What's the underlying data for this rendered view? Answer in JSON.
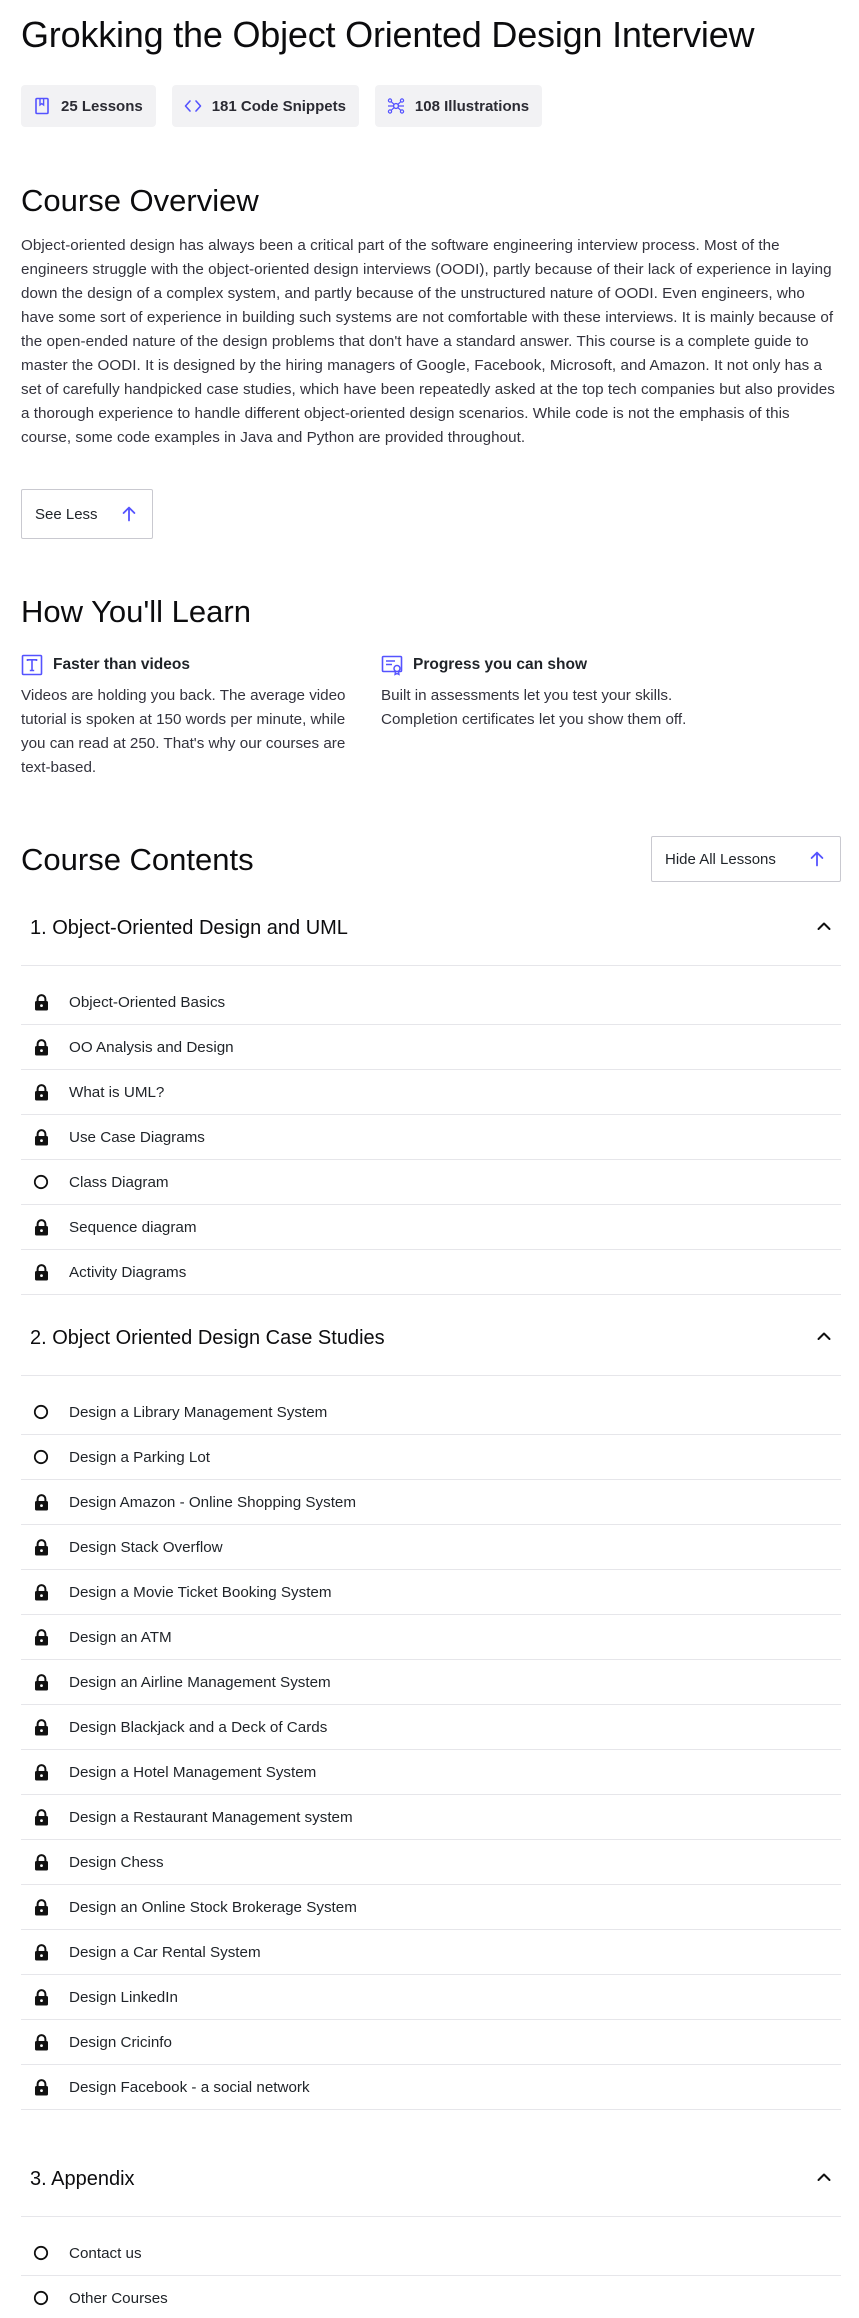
{
  "course": {
    "title": "Grokking the Object Oriented Design Interview",
    "stats": [
      {
        "icon": "book-icon",
        "label": "25 Lessons"
      },
      {
        "icon": "code-icon",
        "label": "181 Code Snippets"
      },
      {
        "icon": "illustration-icon",
        "label": "108 Illustrations"
      }
    ]
  },
  "overview": {
    "heading": "Course Overview",
    "text": "Object-oriented design has always been a critical part of the software engineering interview process. Most of the engineers struggle with the object-oriented design interviews (OODI), partly because of their lack of experience in laying down the design of a complex system, and partly because of the unstructured nature of OODI. Even engineers, who have some sort of experience in building such systems are not comfortable with these interviews. It is mainly because of the open-ended nature of the design problems that don't have a standard answer. This course is a complete guide to master the OODI. It is designed by the hiring managers of Google, Facebook, Microsoft, and Amazon. It not only has a set of carefully handpicked case studies, which have been repeatedly asked at the top tech companies but also provides a thorough experience to handle different object-oriented design scenarios. While code is not the emphasis of this course, some code examples in Java and Python are provided throughout.",
    "toggle_label": "See Less"
  },
  "learn": {
    "heading": "How You'll Learn",
    "items": [
      {
        "icon": "text-icon",
        "title": "Faster than videos",
        "text": "Videos are holding you back. The average video tutorial is spoken at 150 words per minute, while you can read at 250. That's why our courses are text-based."
      },
      {
        "icon": "certificate-icon",
        "title": "Progress you can show",
        "text": "Built in assessments let you test your skills. Completion certificates let you show them off."
      }
    ]
  },
  "contents": {
    "heading": "Course Contents",
    "toggle_all_label": "Hide All Lessons",
    "sections": [
      {
        "title": "1. Object-Oriented Design and UML",
        "lessons": [
          {
            "label": "Object-Oriented Basics",
            "status": "locked"
          },
          {
            "label": "OO Analysis and Design",
            "status": "locked"
          },
          {
            "label": "What is UML?",
            "status": "locked"
          },
          {
            "label": "Use Case Diagrams",
            "status": "locked"
          },
          {
            "label": "Class Diagram",
            "status": "open"
          },
          {
            "label": "Sequence diagram",
            "status": "locked"
          },
          {
            "label": "Activity Diagrams",
            "status": "locked"
          }
        ]
      },
      {
        "title": "2. Object Oriented Design Case Studies",
        "lessons": [
          {
            "label": "Design a Library Management System",
            "status": "open"
          },
          {
            "label": "Design a Parking Lot",
            "status": "open"
          },
          {
            "label": "Design Amazon - Online Shopping System",
            "status": "locked"
          },
          {
            "label": "Design Stack Overflow",
            "status": "locked"
          },
          {
            "label": "Design a Movie Ticket Booking System",
            "status": "locked"
          },
          {
            "label": "Design an ATM",
            "status": "locked"
          },
          {
            "label": "Design an Airline Management System",
            "status": "locked"
          },
          {
            "label": "Design Blackjack and a Deck of Cards",
            "status": "locked"
          },
          {
            "label": "Design a Hotel Management System",
            "status": "locked"
          },
          {
            "label": "Design a Restaurant Management system",
            "status": "locked"
          },
          {
            "label": "Design Chess",
            "status": "locked"
          },
          {
            "label": "Design an Online Stock Brokerage System",
            "status": "locked"
          },
          {
            "label": "Design a Car Rental System",
            "status": "locked"
          },
          {
            "label": "Design LinkedIn",
            "status": "locked"
          },
          {
            "label": "Design Cricinfo",
            "status": "locked"
          },
          {
            "label": "Design Facebook - a social network",
            "status": "locked"
          }
        ]
      },
      {
        "title": "3. Appendix",
        "lessons": [
          {
            "label": "Contact us",
            "status": "open"
          },
          {
            "label": "Other Courses",
            "status": "open"
          }
        ]
      }
    ]
  },
  "colors": {
    "accent": "#5553ff",
    "chip_bg": "#f2f2f4",
    "divider": "#e6e6ea"
  }
}
